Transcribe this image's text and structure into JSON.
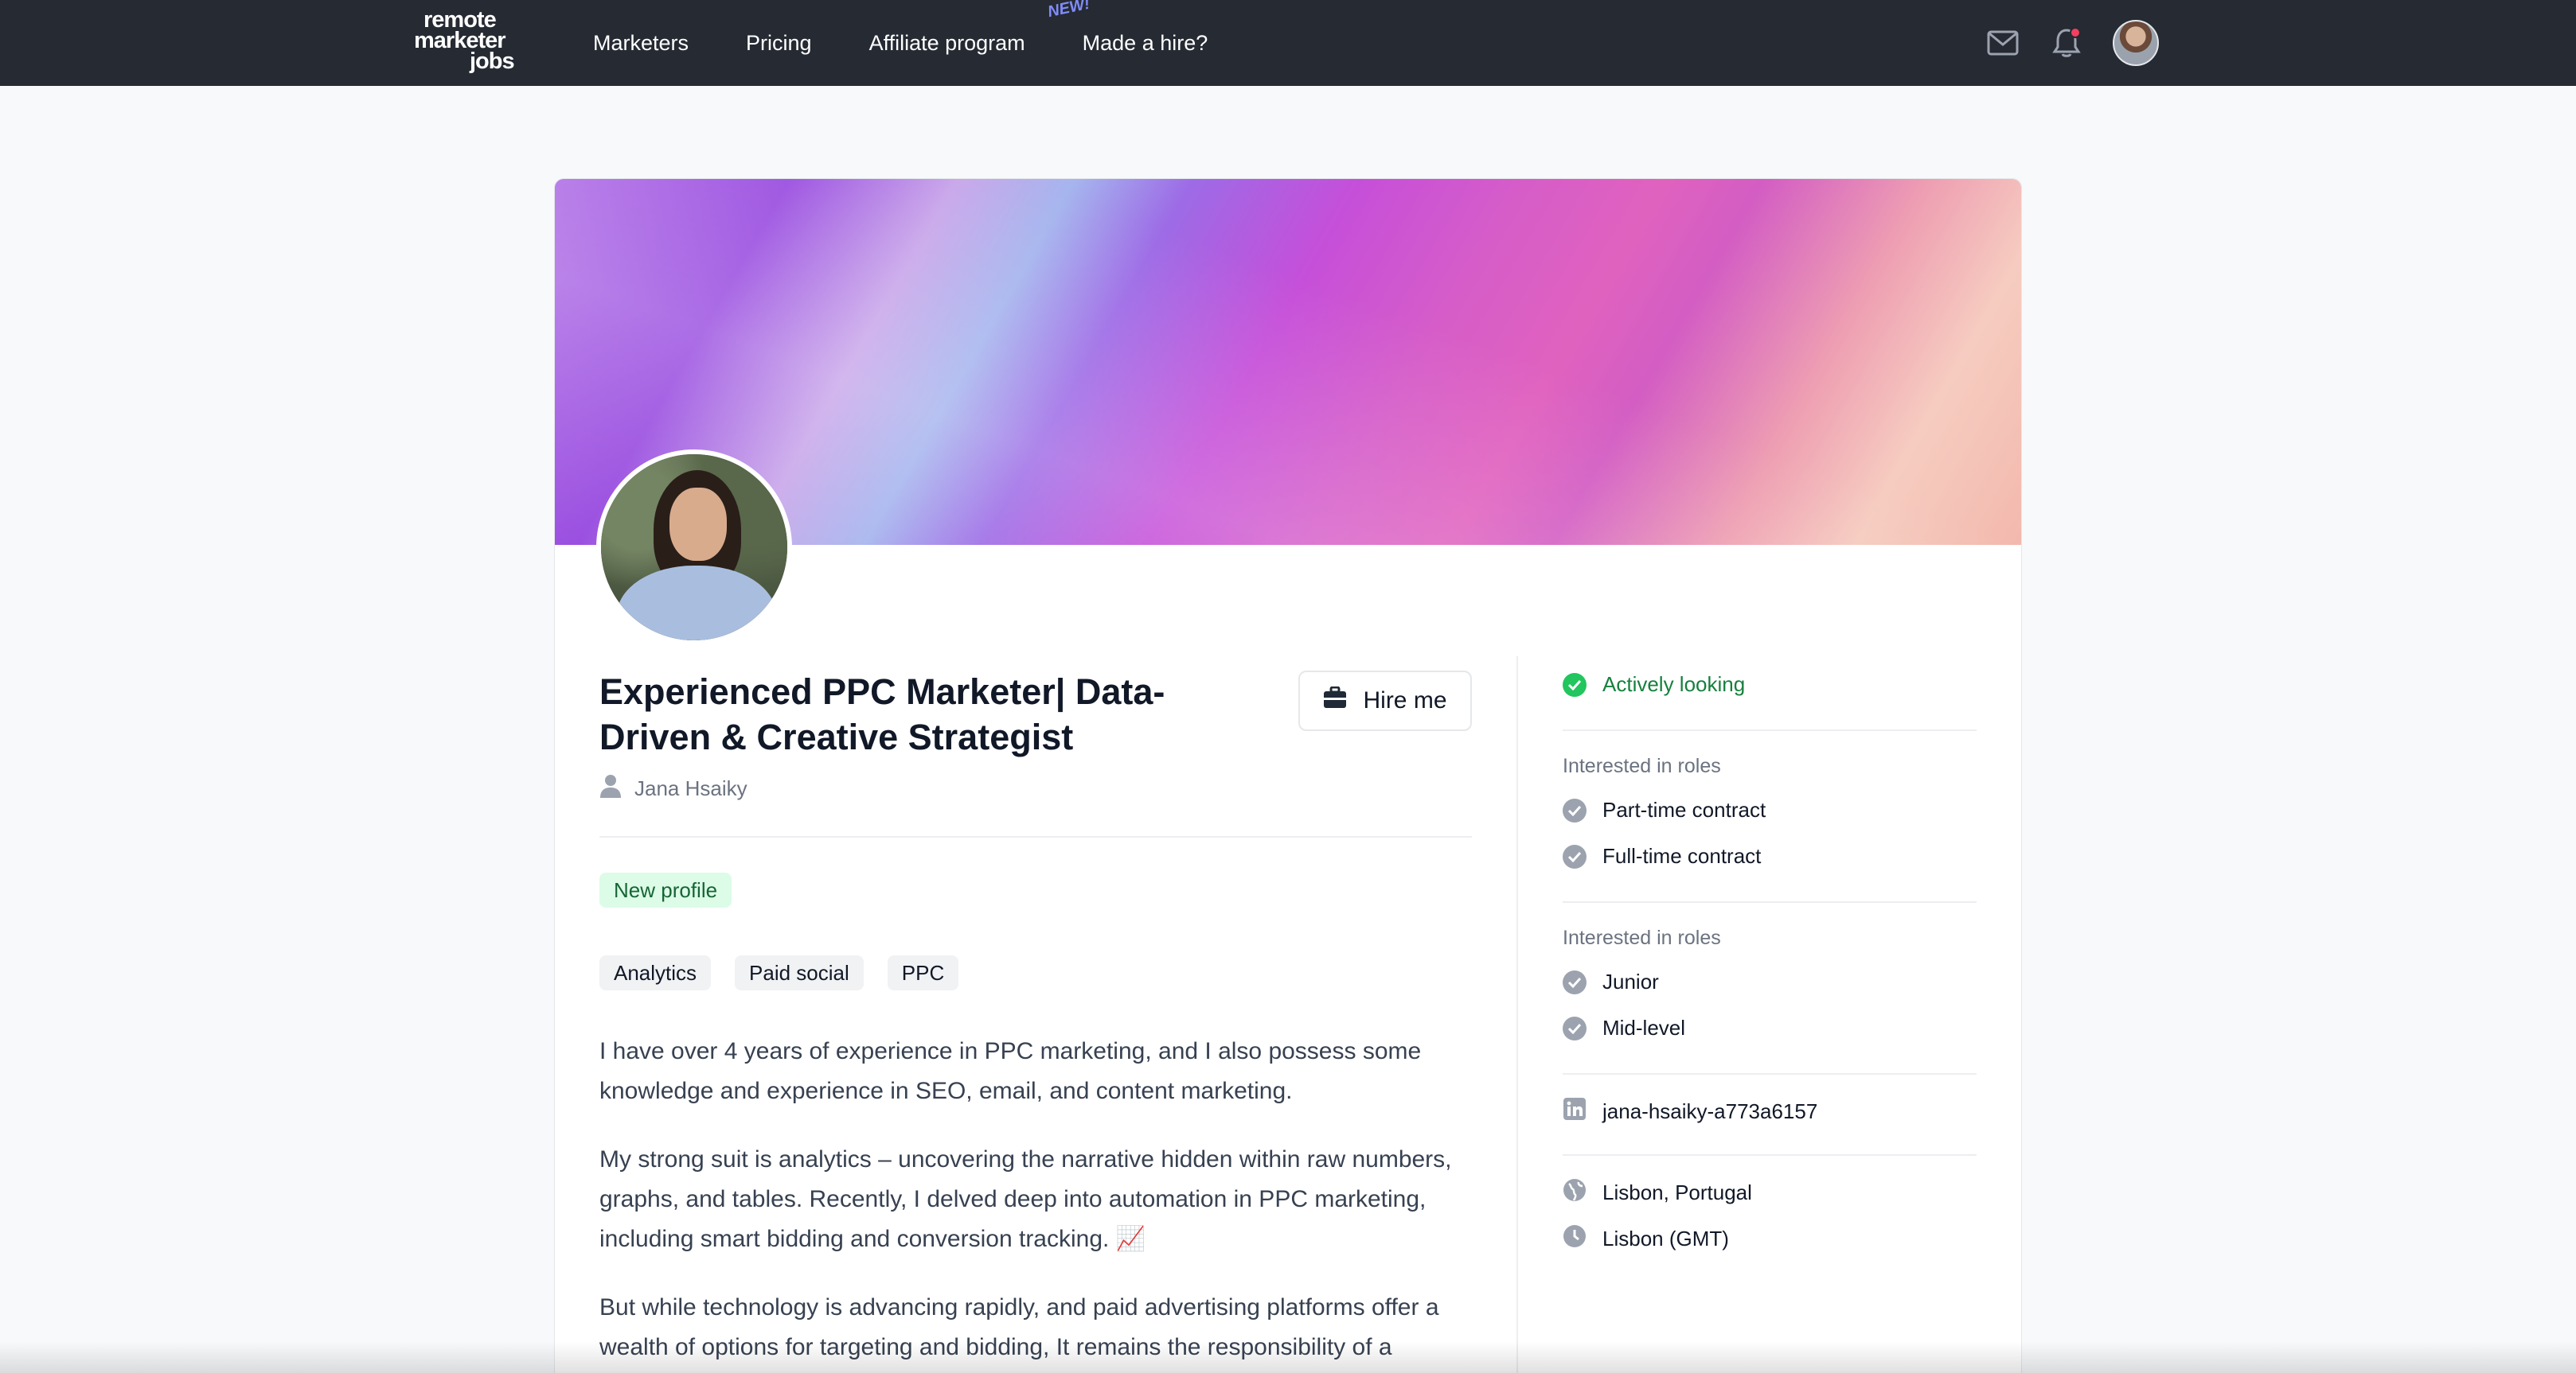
{
  "nav": {
    "logo_lines": [
      "remote",
      "marketer",
      "jobs"
    ],
    "links": [
      "Marketers",
      "Pricing",
      "Affiliate program",
      "Made a hire?"
    ],
    "new_badge": "NEW!"
  },
  "icons": {
    "mail": "mail-icon",
    "bell": "bell-icon",
    "avatar": "avatar",
    "briefcase": "briefcase-icon",
    "user": "user-icon",
    "check": "check-circle-icon",
    "linkedin": "linkedin-icon",
    "globe": "globe-icon",
    "clock": "clock-icon"
  },
  "colors": {
    "nav_bg": "#252a33",
    "active_green": "#15803d",
    "new_profile_bg": "#dcfce7"
  },
  "profile": {
    "title": "Experienced PPC Marketer| Data-Driven & Creative Strategist",
    "hire_label": "Hire me",
    "name": "Jana Hsaiky",
    "new_profile_label": "New profile",
    "tags": [
      "Analytics",
      "Paid social",
      "PPC"
    ],
    "bio": [
      "I have over 4 years of experience in PPC marketing, and I also possess some knowledge and experience in SEO, email, and content marketing.",
      "My strong suit is analytics – uncovering the narrative hidden within raw numbers, graphs, and tables. Recently, I delved deep into automation in PPC marketing, including smart bidding and conversion tracking. 📈",
      "But while technology is advancing rapidly, and paid advertising platforms offer a wealth of options for targeting and bidding, It remains the responsibility of a"
    ]
  },
  "sidebar": {
    "status": "Actively looking",
    "roles_label": "Interested in roles",
    "roles": [
      "Part-time contract",
      "Full-time contract"
    ],
    "levels_label": "Interested in roles",
    "levels": [
      "Junior",
      "Mid-level"
    ],
    "linkedin": "jana-hsaiky-a773a6157",
    "location": "Lisbon, Portugal",
    "timezone": "Lisbon (GMT)"
  }
}
